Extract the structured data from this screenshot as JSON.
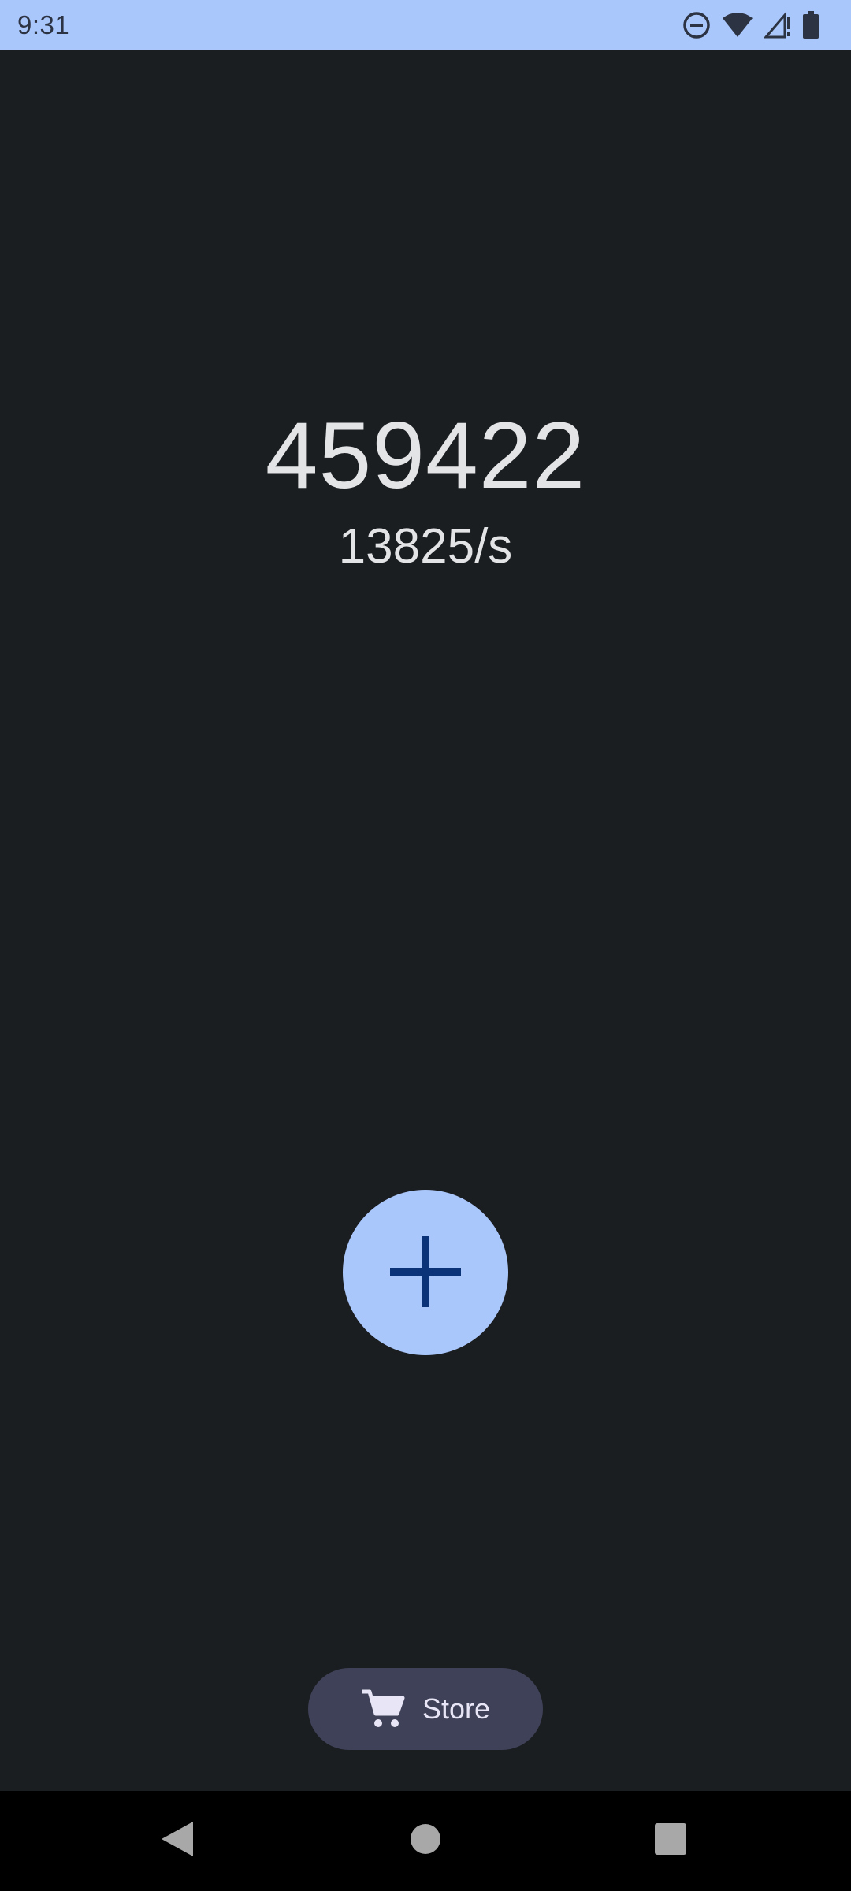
{
  "status_bar": {
    "time": "9:31",
    "icons": [
      "do-not-disturb-icon",
      "wifi-icon",
      "cellular-signal-icon",
      "battery-icon"
    ]
  },
  "game": {
    "counter": "459422",
    "rate": "13825/s",
    "add_button_icon": "plus-icon"
  },
  "store_button": {
    "icon": "cart-icon",
    "label": "Store"
  },
  "nav_bar": {
    "buttons": [
      "back-icon",
      "home-icon",
      "recents-icon"
    ]
  },
  "colors": {
    "status_bar_bg": "#aac7fb",
    "app_bg": "#1b1e21",
    "primary_container": "#aac7fb",
    "on_primary_container": "#0b3478",
    "store_bg": "#3f4158",
    "text": "#e3e4e6"
  }
}
